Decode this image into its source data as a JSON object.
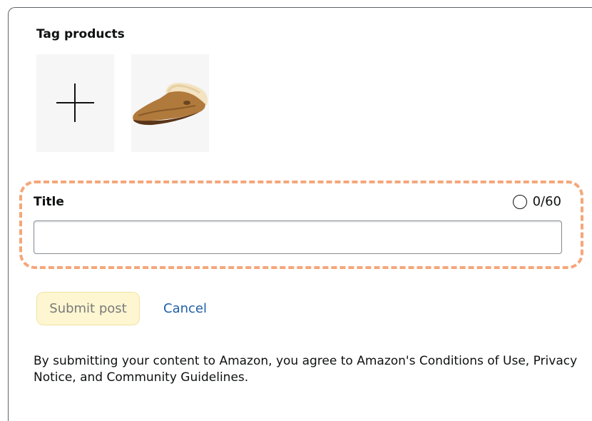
{
  "section": {
    "title": "Tag products"
  },
  "tiles": {
    "add_icon": "plus-icon",
    "product_image": "ugg-slipper-product-image"
  },
  "title_field": {
    "label": "Title",
    "counter": "0/60",
    "counter_icon": "circle-icon",
    "value": "",
    "placeholder": ""
  },
  "actions": {
    "submit_label": "Submit post",
    "cancel_label": "Cancel"
  },
  "disclaimer": "By submitting your content to Amazon, you agree to Amazon's Conditions of Use, Privacy Notice, and Community Guidelines.",
  "colors": {
    "highlight": "#f5a67a",
    "submit_bg": "#fdf6d1",
    "link": "#1f5fa8"
  }
}
